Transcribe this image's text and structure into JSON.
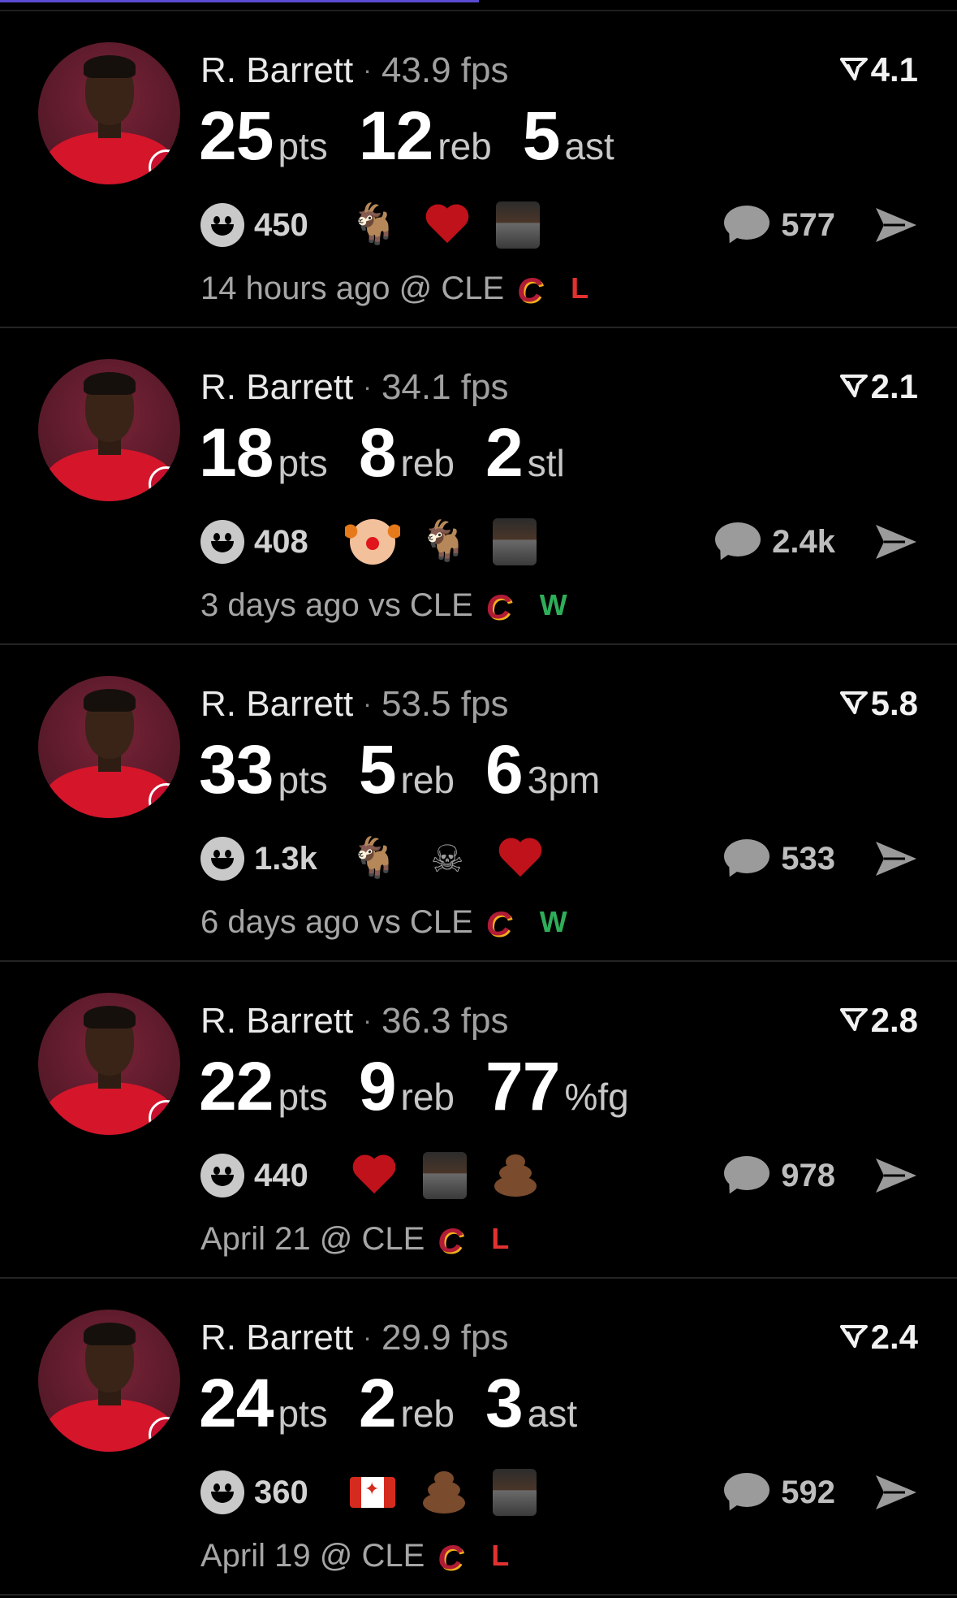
{
  "colors": {
    "background": "#000000",
    "loss": "#e23131",
    "win": "#2fae5a",
    "accent": "#5b4bd1"
  },
  "icons": {
    "reaction_summary": "smiley-icon",
    "comments": "speech-bubble-icon",
    "share": "paper-plane-icon",
    "rating": "funnel-icon",
    "team_logo": "cavaliers-logo"
  },
  "cards": [
    {
      "name": "R. Barrett",
      "separator": "·",
      "fps": "43.9 fps",
      "rating": "4.1",
      "stats": [
        {
          "value": "25",
          "unit": "pts"
        },
        {
          "value": "12",
          "unit": "reb"
        },
        {
          "value": "5",
          "unit": "ast"
        }
      ],
      "reaction_count": "450",
      "reactions": [
        "goat-emoji",
        "heart-emoji",
        "player-photo-emoji"
      ],
      "comment_count": "577",
      "time": "14 hours ago @ CLE",
      "result": "L"
    },
    {
      "name": "R. Barrett",
      "separator": "·",
      "fps": "34.1 fps",
      "rating": "2.1",
      "stats": [
        {
          "value": "18",
          "unit": "pts"
        },
        {
          "value": "8",
          "unit": "reb"
        },
        {
          "value": "2",
          "unit": "stl"
        }
      ],
      "reaction_count": "408",
      "reactions": [
        "clown-emoji",
        "goat-emoji",
        "person-photo-emoji"
      ],
      "comment_count": "2.4k",
      "time": "3 days ago vs CLE",
      "result": "W"
    },
    {
      "name": "R. Barrett",
      "separator": "·",
      "fps": "53.5 fps",
      "rating": "5.8",
      "stats": [
        {
          "value": "33",
          "unit": "pts"
        },
        {
          "value": "5",
          "unit": "reb"
        },
        {
          "value": "6",
          "unit": "3pm"
        }
      ],
      "reaction_count": "1.3k",
      "reactions": [
        "goat-emoji",
        "skull-crossbones-emoji",
        "heart-emoji"
      ],
      "comment_count": "533",
      "time": "6 days ago vs CLE",
      "result": "W"
    },
    {
      "name": "R. Barrett",
      "separator": "·",
      "fps": "36.3 fps",
      "rating": "2.8",
      "stats": [
        {
          "value": "22",
          "unit": "pts"
        },
        {
          "value": "9",
          "unit": "reb"
        },
        {
          "value": "77",
          "unit": "%fg"
        }
      ],
      "reaction_count": "440",
      "reactions": [
        "heart-emoji",
        "person-photo-emoji",
        "poop-emoji"
      ],
      "comment_count": "978",
      "time": "April 21 @ CLE",
      "result": "L"
    },
    {
      "name": "R. Barrett",
      "separator": "·",
      "fps": "29.9 fps",
      "rating": "2.4",
      "stats": [
        {
          "value": "24",
          "unit": "pts"
        },
        {
          "value": "2",
          "unit": "reb"
        },
        {
          "value": "3",
          "unit": "ast"
        }
      ],
      "reaction_count": "360",
      "reactions": [
        "canada-flag-emoji",
        "poop-emoji",
        "player-photo-emoji"
      ],
      "comment_count": "592",
      "time": "April 19 @ CLE",
      "result": "L"
    }
  ]
}
